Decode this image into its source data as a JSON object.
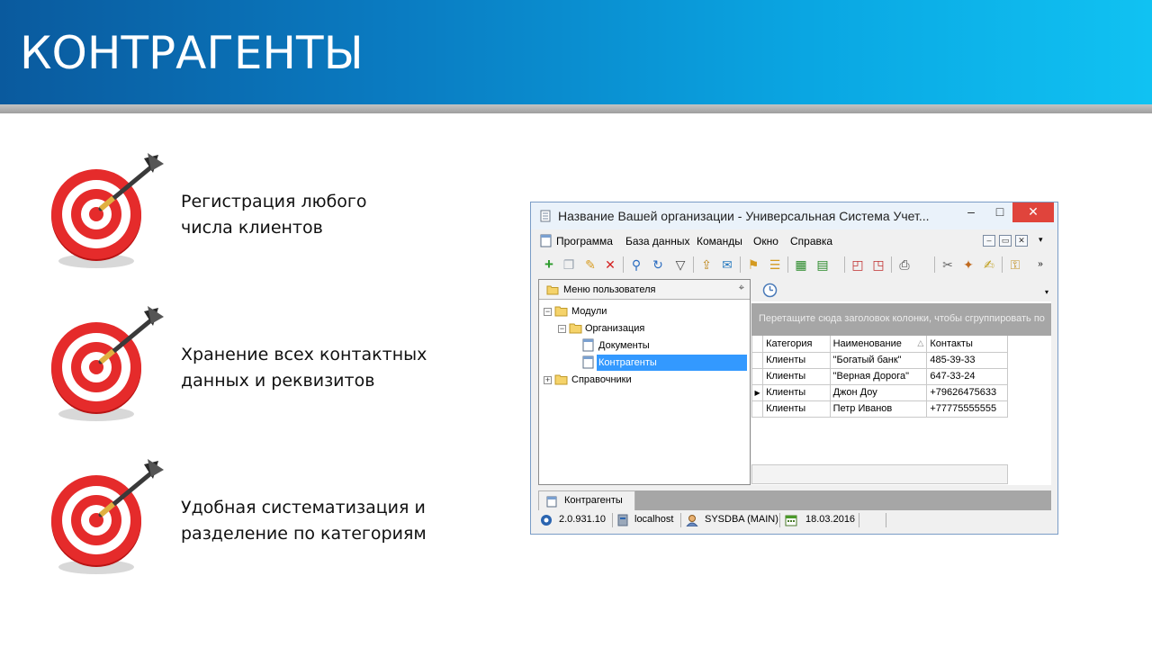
{
  "slide": {
    "title": "КОНТРАГЕНТЫ",
    "features": [
      {
        "line1": "Регистрация любого",
        "line2": "числа клиентов"
      },
      {
        "line1": "Хранение всех контактных",
        "line2": "данных и реквизитов"
      },
      {
        "line1": "Удобная систематизация и",
        "line2": "разделение по категориям"
      }
    ]
  },
  "window": {
    "title": "Название Вашей организации - Универсальная Система Учет...",
    "controls": {
      "minimize": "–",
      "maximize": "□",
      "close": "✕"
    },
    "menu": [
      "Программа",
      "База данных",
      "Команды",
      "Окно",
      "Справка"
    ],
    "mdi": {
      "minimize": "–",
      "restore": "▭",
      "close": "✕"
    },
    "left_pane": {
      "header": "Меню пользователя",
      "tree": {
        "modules": "Модули",
        "organization": "Организация",
        "documents": "Документы",
        "counterparties": "Контрагенты",
        "references": "Справочники"
      }
    },
    "grid": {
      "group_hint": "Перетащите сюда заголовок колонки, чтобы сгруппировать по",
      "columns": [
        "Категория",
        "Наименование",
        "Контакты"
      ],
      "rows": [
        [
          "Клиенты",
          "\"Богатый банк\"",
          "485-39-33"
        ],
        [
          "Клиенты",
          "\"Верная Дорога\"",
          "647-33-24"
        ],
        [
          "Клиенты",
          "Джон Доу",
          "+79626475633"
        ],
        [
          "Клиенты",
          "Петр Иванов",
          "+77775555555"
        ]
      ]
    },
    "tab": "Контрагенты",
    "status": {
      "version": "2.0.931.10",
      "server": "localhost",
      "user": "SYSDBA (MAIN)",
      "date": "18.03.2016"
    },
    "colors": {
      "accent": "#3399ff",
      "close": "#e0443c",
      "header_start": "#0a5a9e",
      "header_end": "#10c2f2"
    }
  }
}
